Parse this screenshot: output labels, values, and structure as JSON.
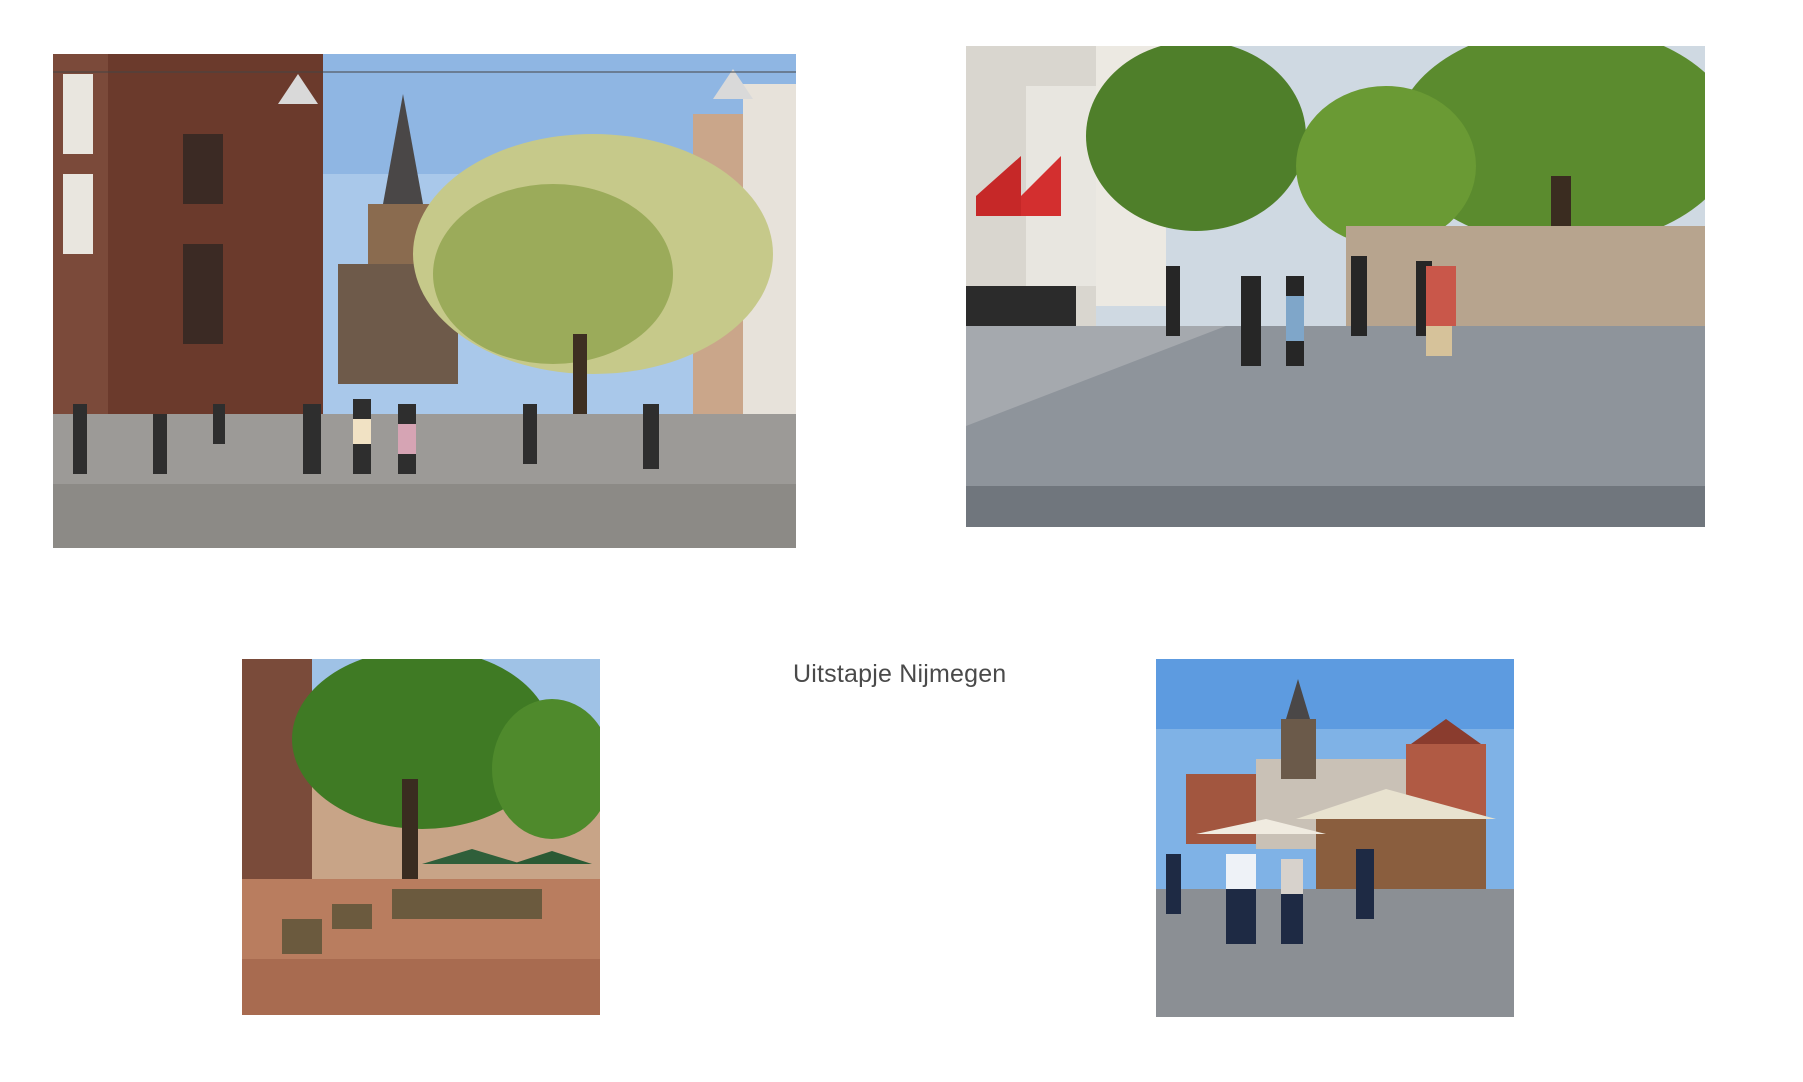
{
  "page": {
    "title": "Uitstapje Nijmegen"
  },
  "photos": [
    {
      "id": "photo-1",
      "subject": "shopping street with church tower and blossoming tree"
    },
    {
      "id": "photo-2",
      "subject": "busy pedestrian shopping street with trees and flags"
    },
    {
      "id": "photo-3",
      "subject": "square with terraces under a large tree"
    },
    {
      "id": "photo-4",
      "subject": "market stalls in front of the church"
    }
  ],
  "colors": {
    "sky": "#a9c8ea",
    "brick": "#6b3a2c",
    "pavement": "#9c9a97",
    "tree": "#6f9c3a",
    "text": "#4a4a4a"
  }
}
